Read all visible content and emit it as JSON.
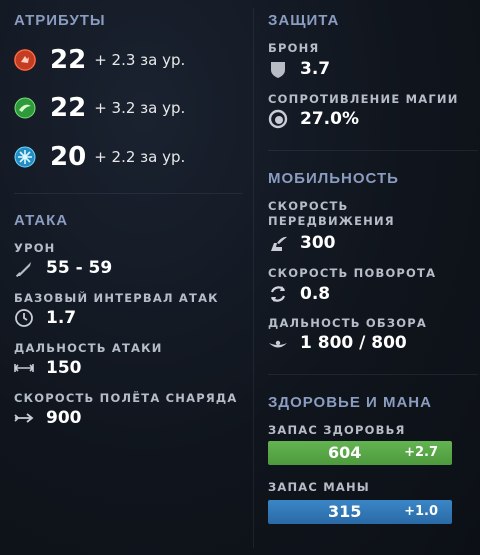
{
  "attributes": {
    "title": "АТРИБУТЫ",
    "strength": {
      "value": "22",
      "gain": "+ 2.3 за ур.",
      "color": "#c43c22"
    },
    "agility": {
      "value": "22",
      "gain": "+ 3.2 за ур.",
      "color": "#2e9a3a"
    },
    "intelligence": {
      "value": "20",
      "gain": "+ 2.2 за ур.",
      "color": "#1f8fc4"
    }
  },
  "attack": {
    "title": "АТАКА",
    "damage_label": "УРОН",
    "damage_value": "55 - 59",
    "interval_label": "БАЗОВЫЙ ИНТЕРВАЛ АТАК",
    "interval_value": "1.7",
    "range_label": "ДАЛЬНОСТЬ АТАКИ",
    "range_value": "150",
    "projectile_label": "СКОРОСТЬ ПОЛЁТА СНАРЯДА",
    "projectile_value": "900"
  },
  "defense": {
    "title": "ЗАЩИТА",
    "armor_label": "БРОНЯ",
    "armor_value": "3.7",
    "magic_res_label": "СОПРОТИВЛЕНИЕ МАГИИ",
    "magic_res_value": "27.0%"
  },
  "mobility": {
    "title": "МОБИЛЬНОСТЬ",
    "move_speed_label_1": "СКОРОСТЬ",
    "move_speed_label_2": "ПЕРЕДВИЖЕНИЯ",
    "move_speed_value": "300",
    "turn_rate_label": "СКОРОСТЬ ПОВОРОТА",
    "turn_rate_value": "0.8",
    "vision_label": "ДАЛЬНОСТЬ ОБЗОРА",
    "vision_value": "1 800 / 800"
  },
  "health_mana": {
    "title": "ЗДОРОВЬЕ И МАНА",
    "health_label": "ЗАПАС ЗДОРОВЬЯ",
    "health_value": "604",
    "health_regen": "+2.7",
    "health_color": "#5cab4a",
    "mana_label": "ЗАПАС МАНЫ",
    "mana_value": "315",
    "mana_regen": "+1.0",
    "mana_color": "#2f78b8"
  }
}
